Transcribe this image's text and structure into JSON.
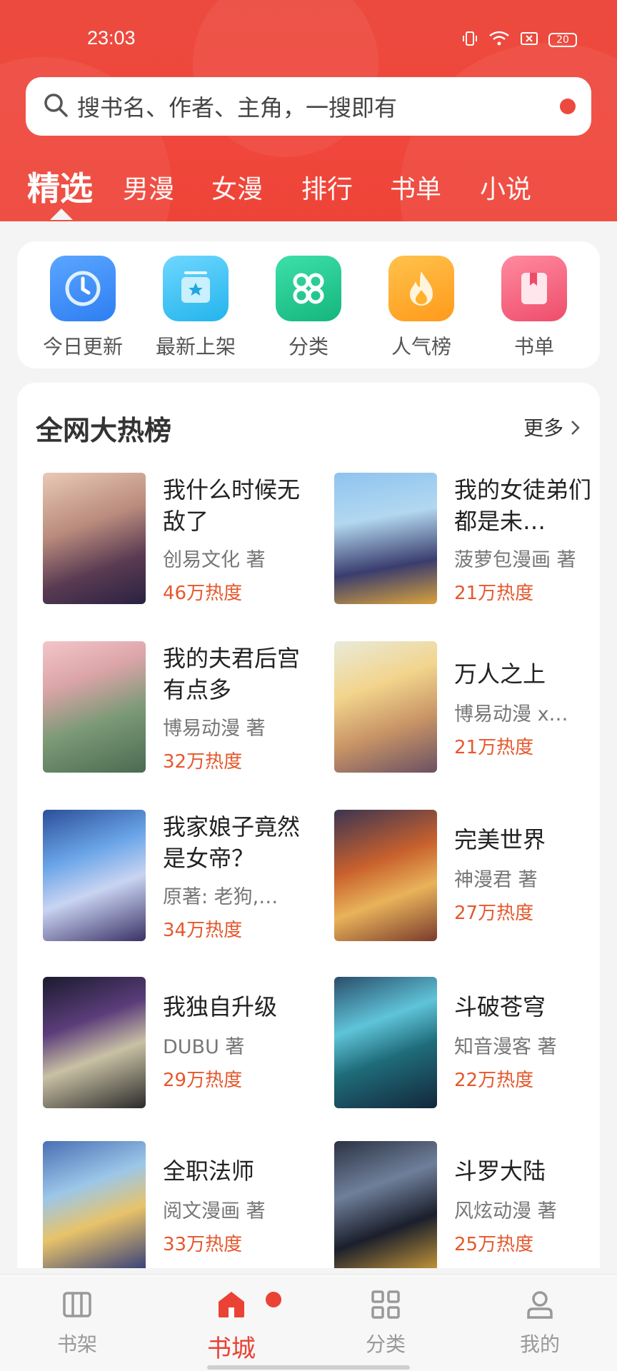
{
  "status": {
    "time": "23:03",
    "battery": "20"
  },
  "search": {
    "placeholder": "搜书名、作者、主角，一搜即有"
  },
  "tabs": [
    "精选",
    "男漫",
    "女漫",
    "排行",
    "书单",
    "小说"
  ],
  "quick": [
    {
      "label": "今日更新",
      "icon": "clock-icon",
      "color": "#3b8cf5"
    },
    {
      "label": "最新上架",
      "icon": "star-box-icon",
      "color": "#3ec3f2"
    },
    {
      "label": "分类",
      "icon": "grid-circles-icon",
      "color": "#21c58e"
    },
    {
      "label": "人气榜",
      "icon": "flame-icon",
      "color": "#ffae2c"
    },
    {
      "label": "书单",
      "icon": "bookmark-icon",
      "color": "#f2607a"
    }
  ],
  "hot": {
    "title": "全网大热榜",
    "more": "更多",
    "books": [
      {
        "title": "我什么时候无敌了",
        "author": "创易文化 著",
        "heat": "46万热度"
      },
      {
        "title": "我的女徒弟们都是未…",
        "author": "菠萝包漫画 著",
        "heat": "21万热度"
      },
      {
        "title": "我的夫君后宫有点多",
        "author": "博易动漫 著",
        "heat": "32万热度"
      },
      {
        "title": "万人之上",
        "author": "博易动漫 x…",
        "heat": "21万热度"
      },
      {
        "title": "我家娘子竟然是女帝？",
        "author": "原著: 老狗,…",
        "heat": "34万热度"
      },
      {
        "title": "完美世界",
        "author": "神漫君 著",
        "heat": "27万热度"
      },
      {
        "title": "我独自升级",
        "author": "DUBU 著",
        "heat": "29万热度"
      },
      {
        "title": "斗破苍穹",
        "author": "知音漫客 著",
        "heat": "22万热度"
      },
      {
        "title": "全职法师",
        "author": "阅文漫画 著",
        "heat": "33万热度"
      },
      {
        "title": "斗罗大陆",
        "author": "风炫动漫 著",
        "heat": "25万热度"
      }
    ]
  },
  "nav": [
    "书架",
    "书城",
    "分类",
    "我的"
  ],
  "colors": {
    "brand": "#ec4a3e",
    "heat": "#e5582d"
  }
}
